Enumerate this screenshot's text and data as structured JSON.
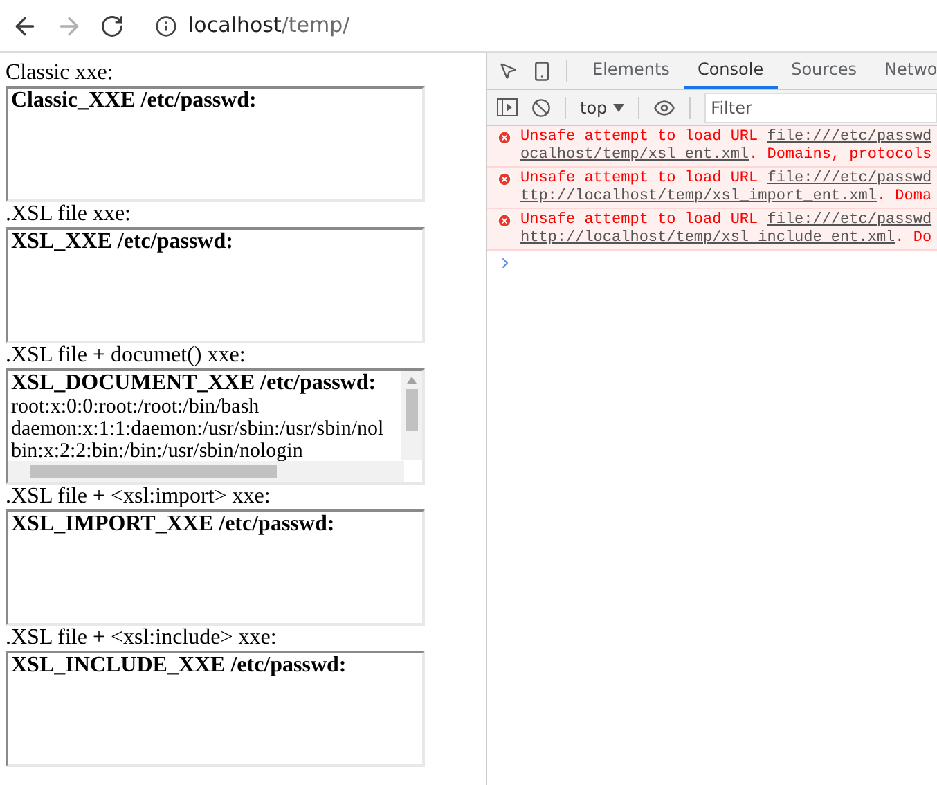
{
  "browser": {
    "url_host": "localhost",
    "url_path": "/temp/"
  },
  "frames": [
    {
      "label": "Classic xxe:",
      "heading": "Classic_XXE /etc/passwd:",
      "scrollbars": false
    },
    {
      "label": ".XSL file xxe:",
      "heading": "XSL_XXE /etc/passwd:",
      "scrollbars": false
    },
    {
      "label": ".XSL file + documet() xxe:",
      "heading": "XSL_DOCUMENT_XXE /etc/passwd:",
      "lines": [
        "root:x:0:0:root:/root:/bin/bash",
        "daemon:x:1:1:daemon:/usr/sbin:/usr/sbin/nol",
        "bin:x:2:2:bin:/bin:/usr/sbin/nologin"
      ],
      "scrollbars": true
    },
    {
      "label": ".XSL file + <xsl:import> xxe:",
      "heading": "XSL_IMPORT_XXE /etc/passwd:",
      "scrollbars": false
    },
    {
      "label": ".XSL file + <xsl:include> xxe:",
      "heading": "XSL_INCLUDE_XXE /etc/passwd:",
      "scrollbars": false
    }
  ],
  "devtools": {
    "tabs": [
      {
        "label": "Elements",
        "selected": false
      },
      {
        "label": "Console",
        "selected": true
      },
      {
        "label": "Sources",
        "selected": false
      },
      {
        "label": "Netwo",
        "selected": false
      }
    ],
    "context": "top",
    "filter_placeholder": "Filter",
    "messages": [
      {
        "text": "Unsafe attempt to load URL",
        "link1": "file:///etc/passwd",
        "link2": "ocalhost/temp/xsl_ent.xml",
        "tail": ". Domains, protocols"
      },
      {
        "text": "Unsafe attempt to load URL",
        "link1": "file:///etc/passwd",
        "link2": "ttp://localhost/temp/xsl_import_ent.xml",
        "tail": ". Doma"
      },
      {
        "text": "Unsafe attempt to load URL",
        "link1": "file:///etc/passwd",
        "link2": "http://localhost/temp/xsl_include_ent.xml",
        "tail": ". Do"
      }
    ]
  }
}
